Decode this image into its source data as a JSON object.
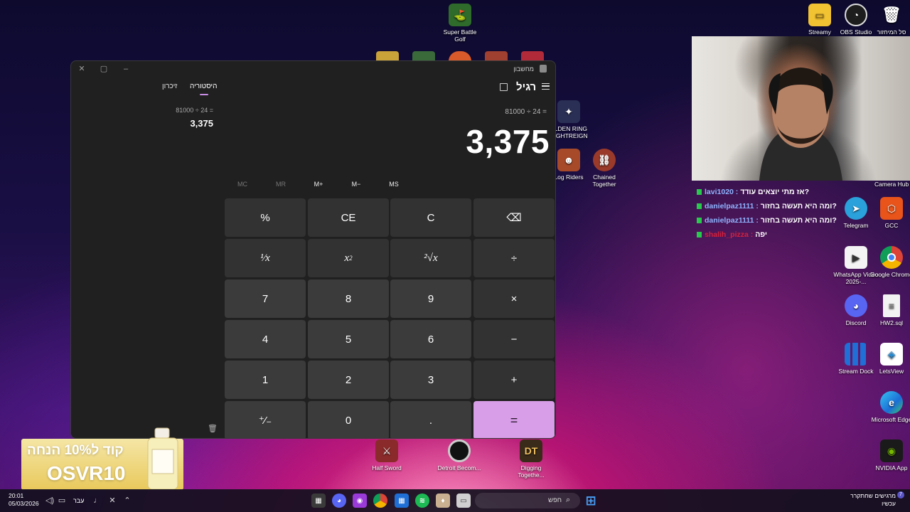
{
  "desktop": {
    "icons": [
      {
        "label": "Super Battle Golf",
        "icon": "golf-ball-icon",
        "color": "#2f6b2a"
      },
      {
        "label": "Streamy",
        "icon": "folder-icon",
        "color": "#f1c232"
      },
      {
        "label": "OBS Studio",
        "icon": "obs-icon",
        "color": "#1d1d1d"
      },
      {
        "label": "סל המיחזור",
        "icon": "recycle-bin-icon",
        "color": "#5aa0d8"
      },
      {
        "label": "ELDEN RING NIGHTREIGN",
        "icon": "elden-ring-icon",
        "color": "#2a2f55"
      },
      {
        "label": "Log Riders",
        "icon": "log-riders-icon",
        "color": "#a64a2a"
      },
      {
        "label": "Chained Together",
        "icon": "chained-together-icon",
        "color": "#9a3a2a"
      },
      {
        "label": "Telegram",
        "icon": "telegram-icon",
        "color": "#2aa1da"
      },
      {
        "label": "GCC",
        "icon": "gcc-icon",
        "color": "#e8541a"
      },
      {
        "label": "WhatsApp Video 2025-...",
        "icon": "video-file-icon",
        "color": "#ffffff"
      },
      {
        "label": "Google Chrome",
        "icon": "chrome-icon",
        "color": "#ffffff"
      },
      {
        "label": "Discord",
        "icon": "discord-icon",
        "color": "#5865f2"
      },
      {
        "label": "HW2.sql",
        "icon": "sql-file-icon",
        "color": "#f2f2f2"
      },
      {
        "label": "Stream Dock",
        "icon": "stream-dock-icon",
        "color": "#1f6fd6"
      },
      {
        "label": "LetsView",
        "icon": "letsview-icon",
        "color": "#ffffff"
      },
      {
        "label": "Microsoft Edge",
        "icon": "edge-icon",
        "color": "#1b8fd6"
      },
      {
        "label": "NVIDIA App",
        "icon": "nvidia-icon",
        "color": "#76b900"
      },
      {
        "label": "Half Sword",
        "icon": "half-sword-icon",
        "color": "#8a2a2a"
      },
      {
        "label": "Detroit Becom...",
        "icon": "detroit-icon",
        "color": "#111111"
      },
      {
        "label": "Digging Togethe...",
        "icon": "digging-together-icon",
        "color": "#3a2a1a"
      }
    ]
  },
  "calculator": {
    "window_title": "מחשבון",
    "mode": "רגיל",
    "tabs": {
      "history": "היסטוריה",
      "memory": "זיכרון"
    },
    "expression": "81000 ÷ 24 =",
    "display": "3,375",
    "history": {
      "expression": "81000   ÷   24 =",
      "result": "3,375"
    },
    "memory_buttons": [
      {
        "label": "MC",
        "enabled": false
      },
      {
        "label": "MR",
        "enabled": false
      },
      {
        "label": "M+",
        "enabled": true
      },
      {
        "label": "M−",
        "enabled": true
      },
      {
        "label": "MS",
        "enabled": true
      }
    ],
    "keys": {
      "percent": "%",
      "ce": "CE",
      "c": "C",
      "backspace": "⌫",
      "reciprocal": "¹⁄x",
      "square_base": "x",
      "square_exp": "2",
      "sqrt": "²√x",
      "divide": "÷",
      "k7": "7",
      "k8": "8",
      "k9": "9",
      "multiply": "×",
      "k4": "4",
      "k5": "5",
      "k6": "6",
      "minus": "−",
      "k1": "1",
      "k2": "2",
      "k3": "3",
      "plus": "+",
      "negate": "⁺⁄₋",
      "k0": "0",
      "decimal": ".",
      "equals": "="
    },
    "accent_color": "#d99ee8"
  },
  "webcam": {
    "label": "Camera Hub"
  },
  "chat": [
    {
      "user": "lavi1020",
      "message": "אז מתי יוצאים עודד?",
      "user_color": "#8fb4ff"
    },
    {
      "user": "danielpaz1111",
      "message": "ומה היא תעשה בחזור?",
      "user_color": "#8fb4ff"
    },
    {
      "user": "danielpaz1111",
      "message": "ומה היא תעשה בחזור?",
      "user_color": "#8fb4ff"
    },
    {
      "user": "shalih_pizza",
      "message": "יפה",
      "user_color": "#d8203a"
    }
  ],
  "promo": {
    "line1": "קוד ל10% הנחה",
    "line2": "OSVR10"
  },
  "taskbar": {
    "time": "20:01",
    "date": "05/03/2026",
    "language": "עבר",
    "search_placeholder": "חפש",
    "notification_title": "מרגישים שחתקרר",
    "notification_sub": "עכשיו",
    "notification_count": "7"
  }
}
